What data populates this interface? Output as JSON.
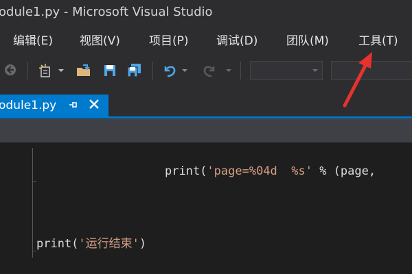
{
  "window": {
    "title": "odule1.py - Microsoft Visual Studio"
  },
  "menu": {
    "items": [
      {
        "label": "编辑(E)"
      },
      {
        "label": "视图(V)"
      },
      {
        "label": "项目(P)"
      },
      {
        "label": "调试(D)"
      },
      {
        "label": "团队(M)"
      },
      {
        "label": "工具(T)"
      }
    ]
  },
  "toolbar": {
    "icons": [
      "back-arrow-icon",
      "new-project-icon",
      "open-folder-icon",
      "save-icon",
      "save-all-icon",
      "undo-icon",
      "redo-icon"
    ],
    "combo1_value": "",
    "combo2_value": ""
  },
  "tabs": [
    {
      "label": "odule1.py",
      "active": true,
      "pinned": false
    }
  ],
  "editor": {
    "line1": {
      "prefix": "print(",
      "string": "'page=%04d  %s'",
      "suffix": " % (page,"
    },
    "line2": {
      "prefix": "print(",
      "string": "'运行结束'",
      "suffix": ")"
    }
  },
  "colors": {
    "accent": "#007acc",
    "string": "#d69d85",
    "annotation": "#e8322d"
  }
}
